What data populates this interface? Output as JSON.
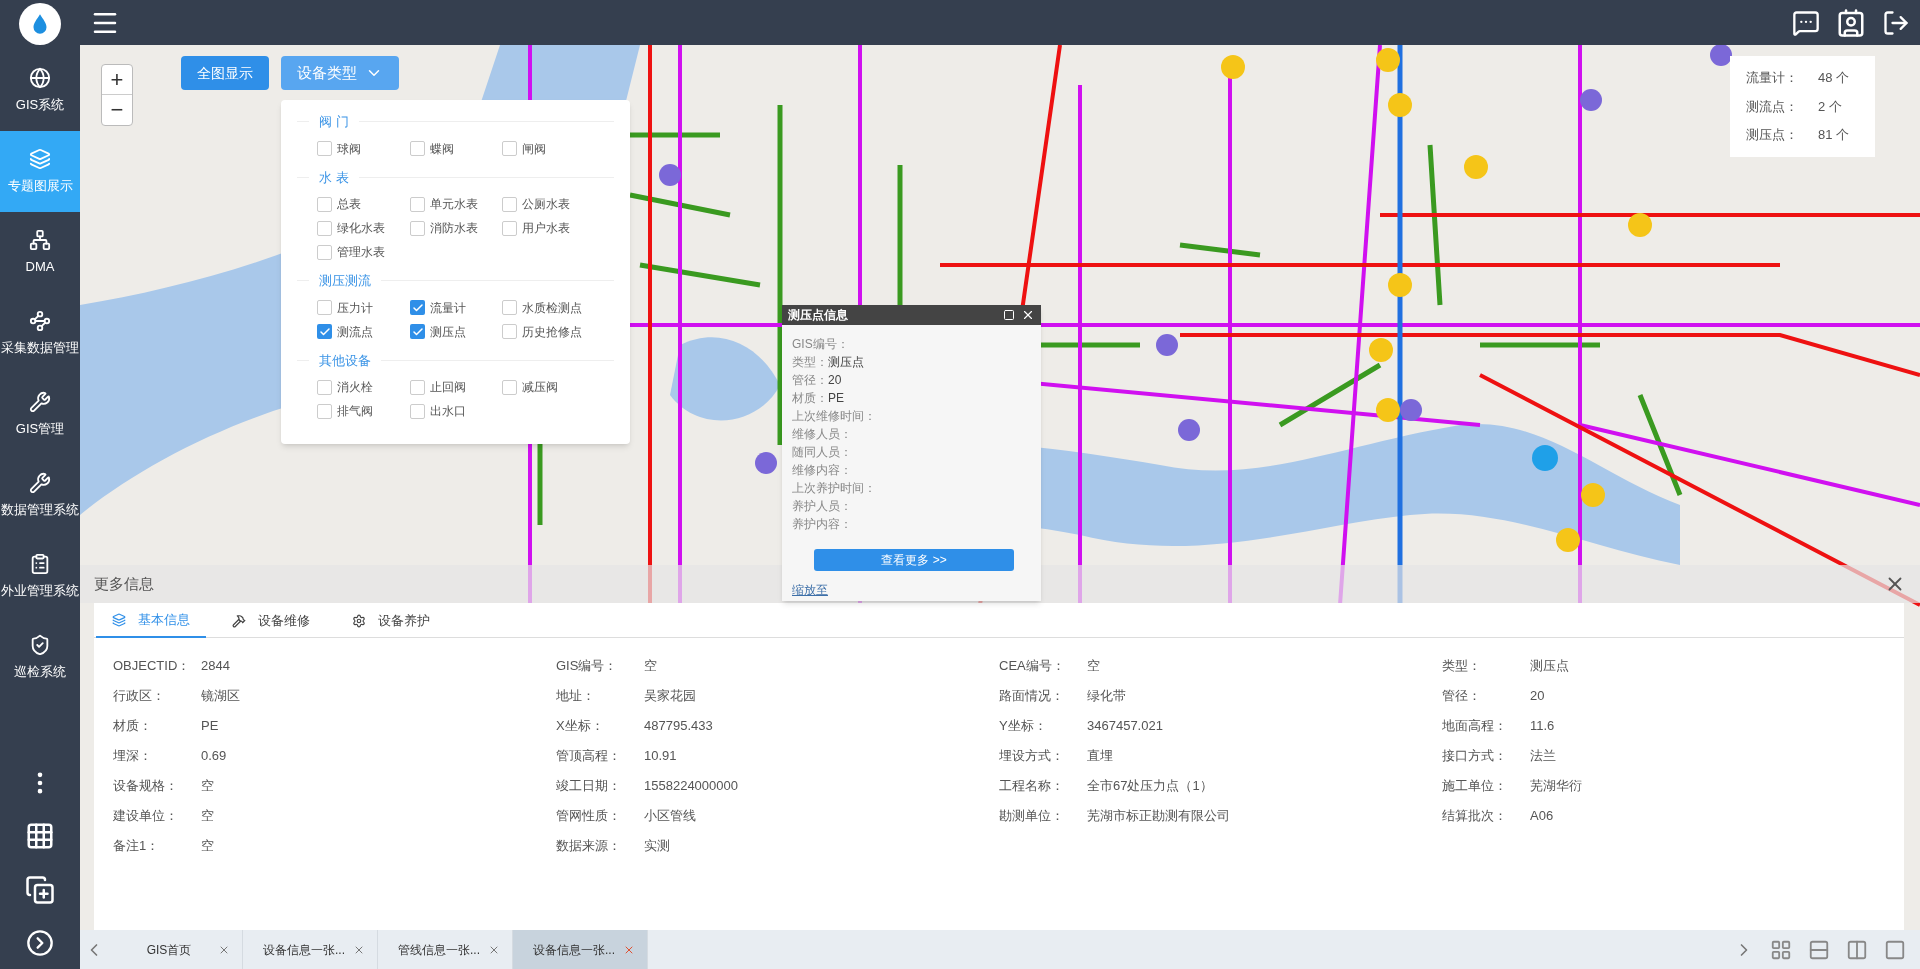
{
  "sidebar": {
    "items": [
      {
        "label": "GIS系统",
        "selected": false
      },
      {
        "label": "专题图展示",
        "selected": true
      },
      {
        "label": "DMA",
        "selected": false
      },
      {
        "label": "采集数据管理",
        "selected": false
      },
      {
        "label": "GIS管理",
        "selected": false
      },
      {
        "label": "数据管理系统",
        "selected": false
      },
      {
        "label": "外业管理系统",
        "selected": false
      },
      {
        "label": "巡检系统",
        "selected": false
      }
    ]
  },
  "map_toolbar": {
    "full_view_button": "全图显示",
    "device_type_button": "设备类型",
    "dropdown_expanded": true
  },
  "zoom": {
    "in": "+",
    "out": "−"
  },
  "device_filter": [
    {
      "title": "阀 门",
      "options": [
        {
          "label": "球阀",
          "checked": false
        },
        {
          "label": "蝶阀",
          "checked": false
        },
        {
          "label": "闸阀",
          "checked": false
        }
      ]
    },
    {
      "title": "水 表",
      "options": [
        {
          "label": "总表",
          "checked": false
        },
        {
          "label": "单元水表",
          "checked": false
        },
        {
          "label": "公厕水表",
          "checked": false
        },
        {
          "label": "绿化水表",
          "checked": false
        },
        {
          "label": "消防水表",
          "checked": false
        },
        {
          "label": "用户水表",
          "checked": false
        },
        {
          "label": "管理水表",
          "checked": false
        }
      ]
    },
    {
      "title": "测压测流",
      "options": [
        {
          "label": "压力计",
          "checked": false
        },
        {
          "label": "流量计",
          "checked": true
        },
        {
          "label": "水质检测点",
          "checked": false
        },
        {
          "label": "测流点",
          "checked": true
        },
        {
          "label": "测压点",
          "checked": true
        },
        {
          "label": "历史抢修点",
          "checked": false
        }
      ]
    },
    {
      "title": "其他设备",
      "options": [
        {
          "label": "消火栓",
          "checked": false
        },
        {
          "label": "止回阀",
          "checked": false
        },
        {
          "label": "减压阀",
          "checked": false
        },
        {
          "label": "排气阀",
          "checked": false
        },
        {
          "label": "出水口",
          "checked": false
        }
      ]
    }
  ],
  "legend": [
    {
      "label": "流量计：",
      "count": "48 个"
    },
    {
      "label": "测流点：",
      "count": "2 个"
    },
    {
      "label": "测压点：",
      "count": "81 个"
    }
  ],
  "popup": {
    "title": "测压点信息",
    "fields": [
      {
        "label": "GIS编号："
      },
      {
        "label": "类型：",
        "value": "测压点"
      },
      {
        "label": "管径：",
        "value": "20"
      },
      {
        "label": "材质：",
        "value": "PE"
      },
      {
        "label": "上次维修时间："
      },
      {
        "label": "维修人员："
      },
      {
        "label": "随同人员："
      },
      {
        "label": "维修内容："
      },
      {
        "label": "上次养护时间："
      },
      {
        "label": "养护人员："
      },
      {
        "label": "养护内容："
      }
    ],
    "more_button": "查看更多 >>",
    "zoom_link": "缩放至"
  },
  "info_panel": {
    "title": "更多信息",
    "tabs": [
      {
        "label": "基本信息",
        "selected": true
      },
      {
        "label": "设备维修",
        "selected": false
      },
      {
        "label": "设备养护",
        "selected": false
      }
    ],
    "rows": [
      [
        {
          "label": "OBJECTID：",
          "value": "2844"
        },
        {
          "label": "GIS编号：",
          "value": "空"
        },
        {
          "label": "CEA编号：",
          "value": "空"
        },
        {
          "label": "类型：",
          "value": "测压点"
        }
      ],
      [
        {
          "label": "行政区：",
          "value": "镜湖区"
        },
        {
          "label": "地址：",
          "value": "吴家花园"
        },
        {
          "label": "路面情况：",
          "value": "绿化带"
        },
        {
          "label": "管径：",
          "value": "20"
        }
      ],
      [
        {
          "label": "材质：",
          "value": "PE"
        },
        {
          "label": "X坐标：",
          "value": "487795.433"
        },
        {
          "label": "Y坐标：",
          "value": "3467457.021"
        },
        {
          "label": "地面高程：",
          "value": "11.6"
        }
      ],
      [
        {
          "label": "埋深：",
          "value": "0.69"
        },
        {
          "label": "管顶高程：",
          "value": "10.91"
        },
        {
          "label": "埋设方式：",
          "value": "直埋"
        },
        {
          "label": "接口方式：",
          "value": "法兰"
        }
      ],
      [
        {
          "label": "设备规格：",
          "value": "空"
        },
        {
          "label": "竣工日期：",
          "value": "1558224000000"
        },
        {
          "label": "工程名称：",
          "value": "全市67处压力点（1）"
        },
        {
          "label": "施工单位：",
          "value": "芜湖华衍"
        }
      ],
      [
        {
          "label": "建设单位：",
          "value": "空"
        },
        {
          "label": "管网性质：",
          "value": "小区管线"
        },
        {
          "label": "勘测单位：",
          "value": "芜湖市标正勘测有限公司"
        },
        {
          "label": "结算批次：",
          "value": "A06"
        }
      ],
      [
        {
          "label": "备注1：",
          "value": "空"
        },
        {
          "label": "数据来源：",
          "value": "实测"
        }
      ]
    ]
  },
  "page_tabs": [
    {
      "label": "GIS首页",
      "selected": false
    },
    {
      "label": "设备信息一张...",
      "selected": false
    },
    {
      "label": "管线信息一张...",
      "selected": false
    },
    {
      "label": "设备信息一张...",
      "selected": true
    }
  ]
}
